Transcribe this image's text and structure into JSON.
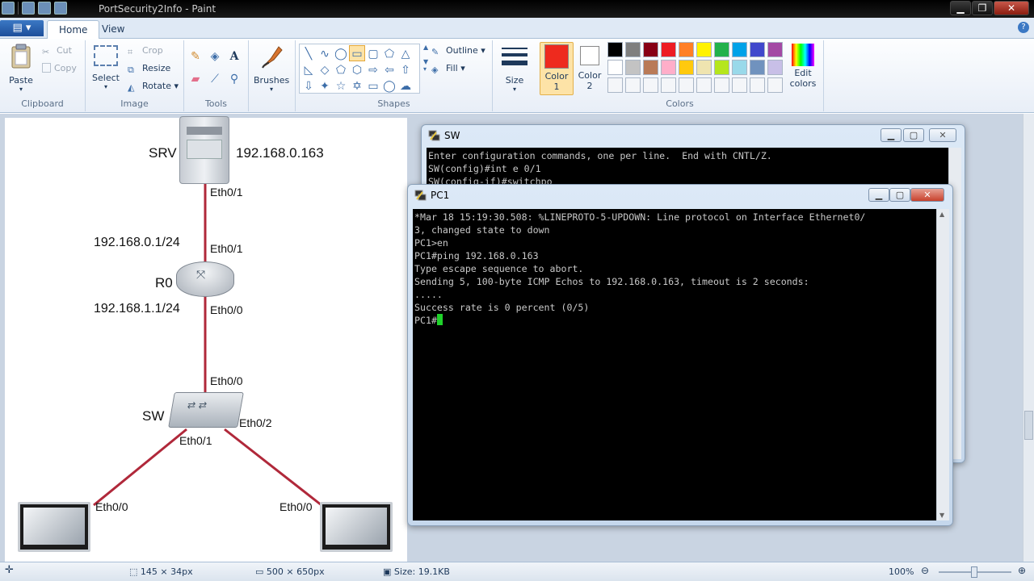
{
  "window": {
    "title": "PortSecurity2Info - Paint"
  },
  "tabs": {
    "file": "▤ ▾",
    "home": "Home",
    "view": "View"
  },
  "ribbon": {
    "clipboard": {
      "label": "Clipboard",
      "paste": "Paste",
      "cut": "Cut",
      "copy": "Copy"
    },
    "image": {
      "label": "Image",
      "select": "Select",
      "crop": "Crop",
      "resize": "Resize",
      "rotate": "Rotate"
    },
    "tools": {
      "label": "Tools"
    },
    "brushes": {
      "label": "Brushes"
    },
    "shapes": {
      "label": "Shapes",
      "outline": "Outline",
      "fill": "Fill"
    },
    "size": {
      "label": "Size"
    },
    "colors": {
      "label": "Colors",
      "color1": "Color",
      "color1_num": "1",
      "color2": "Color",
      "color2_num": "2",
      "edit": "Edit",
      "edit2": "colors",
      "color1_value": "#ee2a1e",
      "color2_value": "#ffffff"
    }
  },
  "palette_row1": [
    "#000000",
    "#7f7f7f",
    "#880015",
    "#ed1c24",
    "#ff7f27",
    "#fff200",
    "#22b14c",
    "#00a2e8",
    "#3f48cc",
    "#a349a4"
  ],
  "palette_row2": [
    "#ffffff",
    "#c3c3c3",
    "#b97a57",
    "#ffaec9",
    "#ffc90e",
    "#efe4b0",
    "#b5e61d",
    "#99d9ea",
    "#7092be",
    "#c8bfe7"
  ],
  "diagram": {
    "srv": "SRV",
    "srv_ip": "192.168.0.163",
    "srv_eth": "Eth0/1",
    "r0_eth1": "Eth0/1",
    "r0_ip1": "192.168.0.1/24",
    "r0": "R0",
    "r0_ip0": "192.168.1.1/24",
    "r0_eth0": "Eth0/0",
    "sw_eth0": "Eth0/0",
    "sw": "SW",
    "sw_eth2": "Eth0/2",
    "sw_eth1": "Eth0/1",
    "pc1_eth": "Eth0/0",
    "pc2_eth": "Eth0/0"
  },
  "sw_window": {
    "title": "SW",
    "lines": [
      "Enter configuration commands, one per line.  End with CNTL/Z.",
      "SW(config)#int e 0/1",
      "SW(config-if)#switchpo"
    ]
  },
  "pc1_window": {
    "title": "PC1",
    "lines": [
      "*Mar 18 15:19:30.508: %LINEPROTO-5-UPDOWN: Line protocol on Interface Ethernet0/",
      "3, changed state to down",
      "PC1>en",
      "PC1#ping 192.168.0.163",
      "Type escape sequence to abort.",
      "Sending 5, 100-byte ICMP Echos to 192.168.0.163, timeout is 2 seconds:",
      ".....",
      "Success rate is 0 percent (0/5)",
      "PC1#"
    ]
  },
  "status": {
    "selection": "145 × 34px",
    "canvas_size": "500 × 650px",
    "file_size": "Size: 19.1KB",
    "zoom": "100%"
  }
}
